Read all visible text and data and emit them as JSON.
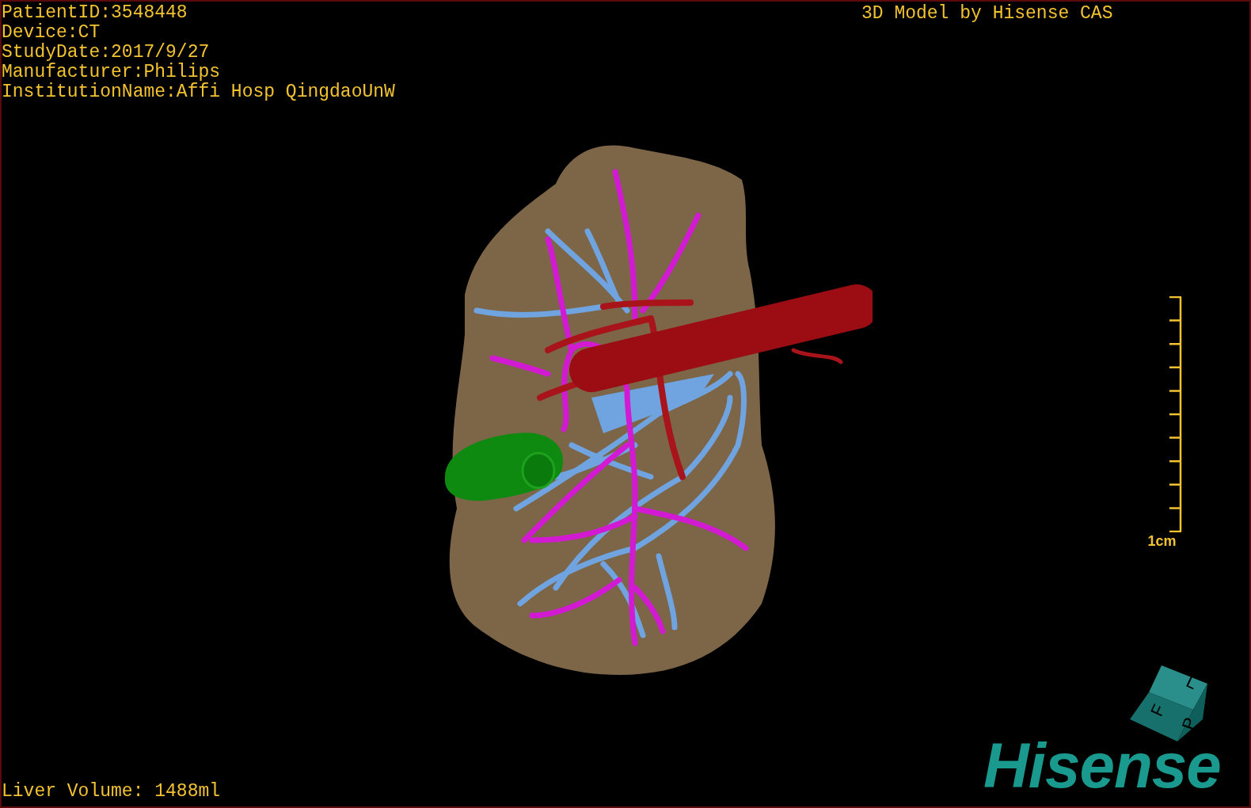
{
  "info_lines": [
    "PatientID:3548448",
    "Device:CT",
    "StudyDate:2017/9/27",
    "Manufacturer:Philips",
    "InstitutionName:Affi Hosp QingdaoUnW"
  ],
  "title": "3D Model by Hisense CAS",
  "scale_bar": {
    "label": "1cm"
  },
  "orientation_cube": {
    "faces": [
      "F",
      "L",
      "P"
    ]
  },
  "logo": "Hisense",
  "volume": "Liver Volume: 1488ml"
}
